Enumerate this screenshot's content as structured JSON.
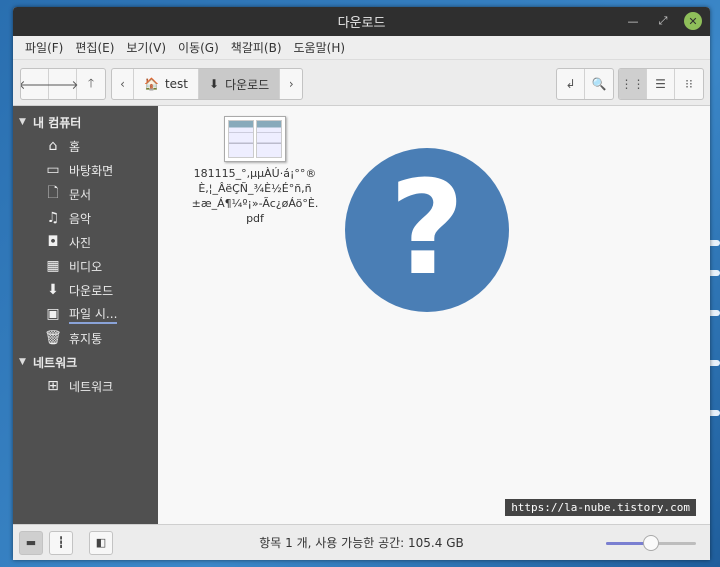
{
  "window": {
    "title": "다운로드"
  },
  "menubar": {
    "items": [
      "파일(F)",
      "편집(E)",
      "보기(V)",
      "이동(G)",
      "책갈피(B)",
      "도움말(H)"
    ]
  },
  "toolbar": {
    "crumbs": [
      "test",
      "다운로드"
    ]
  },
  "sidebar": {
    "computer_header": "내 컴퓨터",
    "items": [
      "홈",
      "바탕화면",
      "문서",
      "음악",
      "사진",
      "비디오",
      "다운로드",
      "파일 시...",
      "휴지통"
    ],
    "network_header": "네트워크",
    "network_items": [
      "네트워크"
    ]
  },
  "files": [
    {
      "name": "181115_°,µµÀÚ·á¡°°®È,¦_ÂëÇÑ_¾È½É°ñ,ñ±æ_Á¶¼º¡»-Ãc¿øÁö°È.pdf"
    }
  ],
  "statusbar": {
    "text": "항목 1 개, 사용 가능한 공간: 105.4 GB",
    "zoom_level": 0.5
  },
  "watermark": "https://la-nube.tistory.com",
  "colors": {
    "accent": "#7a7fd1",
    "sidebar_bg": "#505050",
    "titlebar_bg": "#2f2f2f",
    "unknown_icon": "#4a7eb5"
  }
}
